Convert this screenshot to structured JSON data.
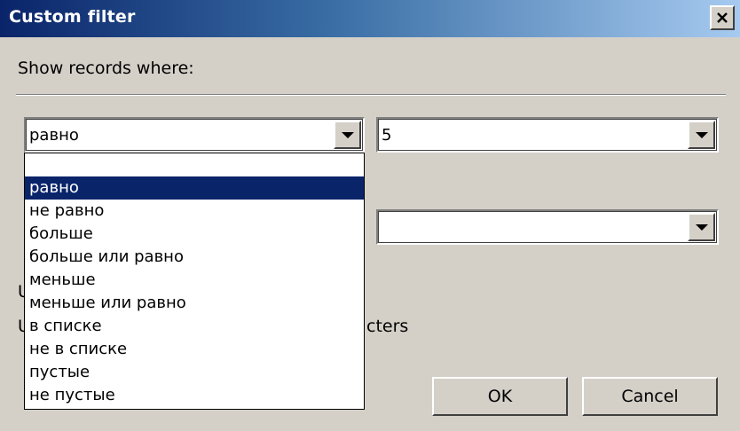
{
  "dialog": {
    "title": "Custom filter",
    "prompt": "Show records where:",
    "condition1": {
      "operator": "равно",
      "value": "5"
    },
    "condition2": {
      "value": ""
    },
    "operator_list": [
      "",
      "равно",
      "не равно",
      "больше",
      "больше или равно",
      "меньше",
      "меньше или равно",
      "в списке",
      "не в списке",
      "пустые",
      "не пустые"
    ],
    "selected_index": 1,
    "partial_labels": {
      "line1": "U",
      "line2": "U",
      "line2_tail": "cters"
    },
    "buttons": {
      "ok": "OK",
      "cancel": "Cancel"
    }
  }
}
